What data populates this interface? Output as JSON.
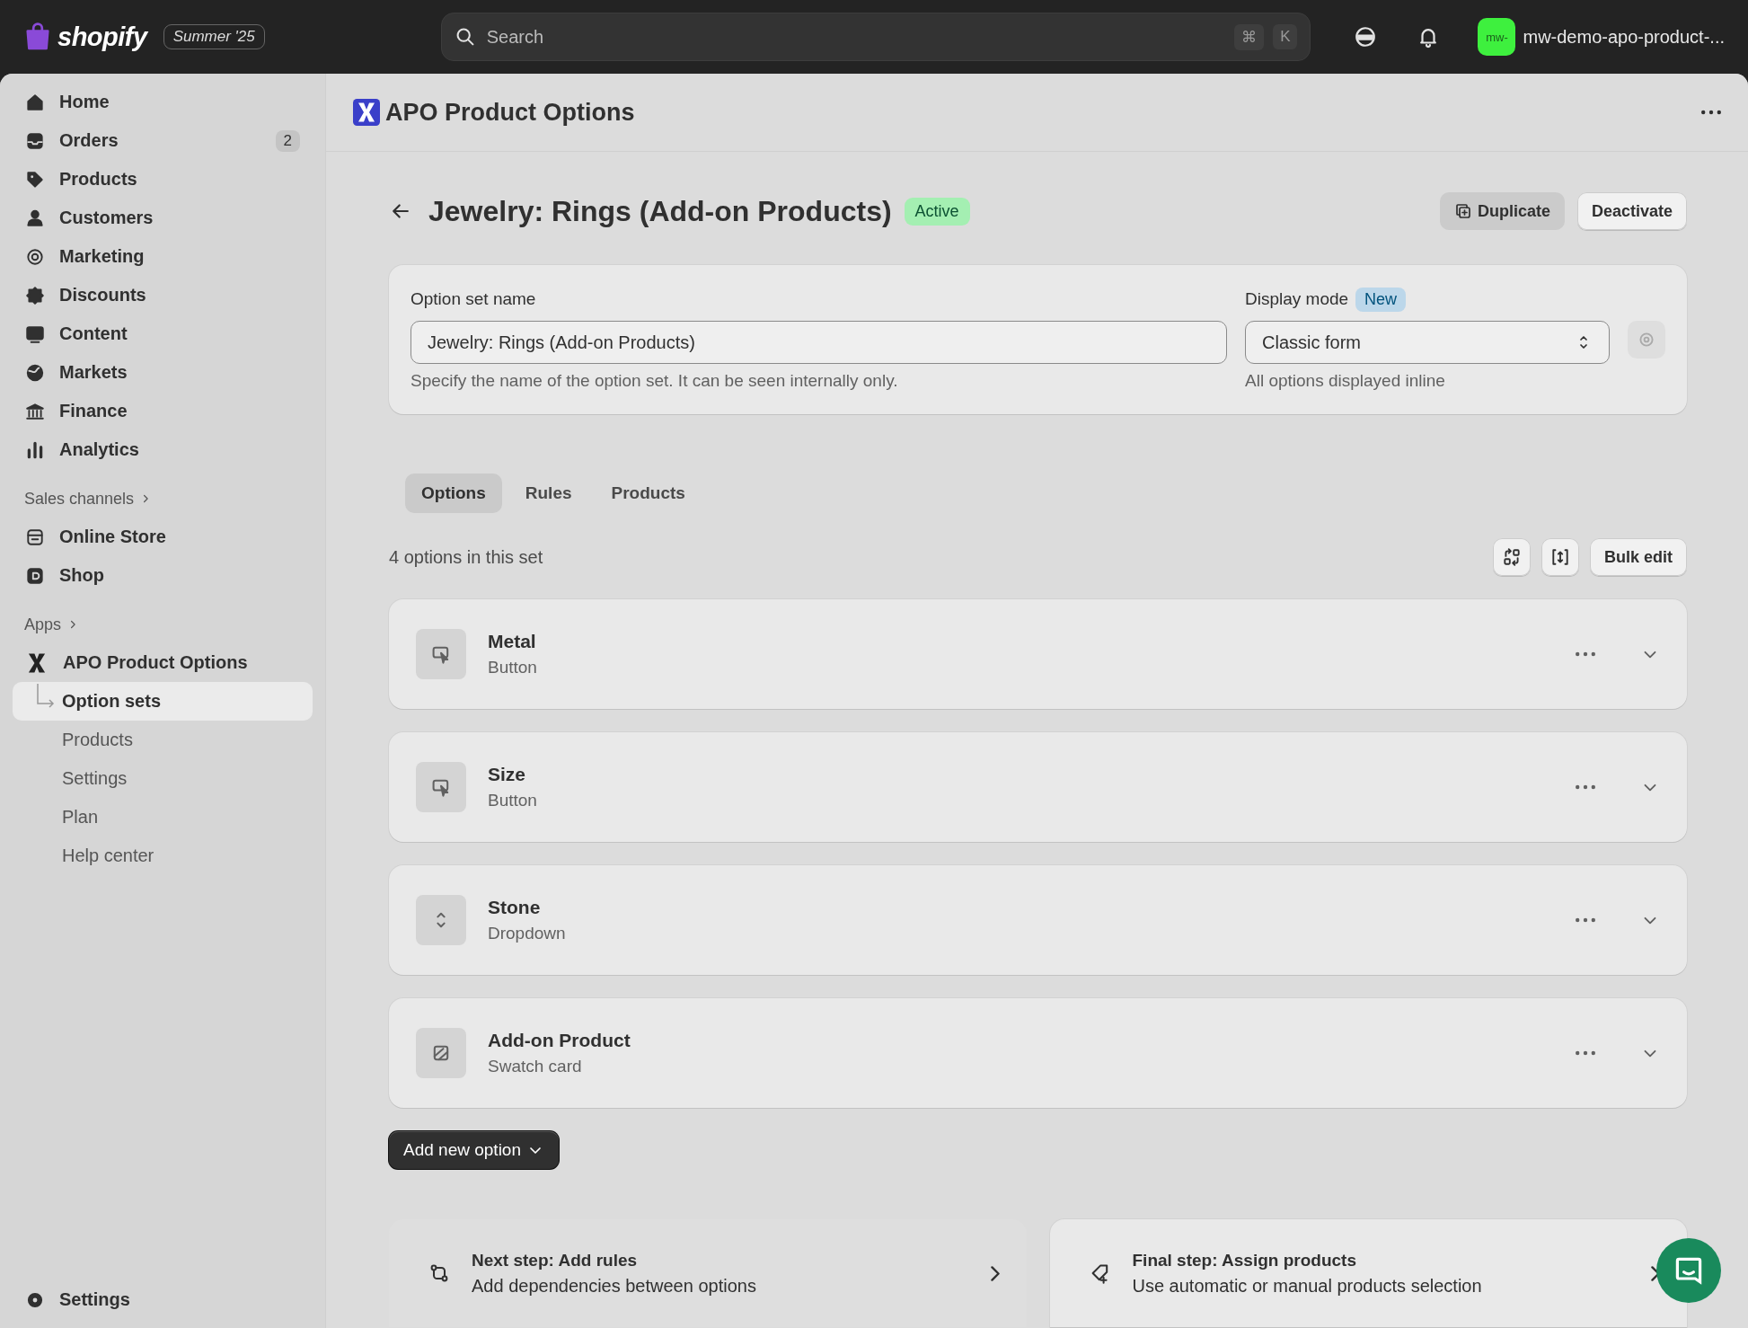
{
  "topbar": {
    "brand": "shopify",
    "edition": "Summer '25",
    "search": {
      "placeholder": "Search"
    },
    "shortcut": [
      "⌘",
      "K"
    ],
    "store": {
      "avatar": "mw-",
      "name": "mw-demo-apo-product-..."
    }
  },
  "sidebar": {
    "items": [
      {
        "label": "Home",
        "selected": false
      },
      {
        "label": "Orders",
        "badge": "2",
        "selected": false
      },
      {
        "label": "Products",
        "selected": false
      },
      {
        "label": "Customers",
        "selected": false
      },
      {
        "label": "Marketing",
        "selected": false
      },
      {
        "label": "Discounts",
        "selected": false
      },
      {
        "label": "Content",
        "selected": false
      },
      {
        "label": "Markets",
        "selected": false
      },
      {
        "label": "Finance",
        "selected": false
      },
      {
        "label": "Analytics",
        "selected": false
      }
    ],
    "sales_channels": {
      "heading": "Sales channels",
      "items": [
        {
          "label": "Online Store",
          "selected": false
        },
        {
          "label": "Shop",
          "selected": false
        }
      ]
    },
    "apps": {
      "heading": "Apps",
      "app": "APO Product Options",
      "children": [
        {
          "label": "Option sets",
          "selected": true
        },
        {
          "label": "Products",
          "selected": false
        },
        {
          "label": "Settings",
          "selected": false
        },
        {
          "label": "Plan",
          "selected": false
        },
        {
          "label": "Help center",
          "selected": false
        }
      ]
    },
    "settings": "Settings"
  },
  "app_header": {
    "title": "APO Product Options"
  },
  "page": {
    "title": "Jewelry: Rings (Add-on Products)",
    "status": "Active",
    "actions": [
      "Duplicate",
      "Deactivate"
    ]
  },
  "form": {
    "name": {
      "label": "Option set name",
      "value": "Jewelry: Rings (Add-on Products)",
      "help": "Specify the name of the option set. It can be seen internally only."
    },
    "display_mode": {
      "label": "Display mode",
      "badge": "New",
      "value": "Classic form",
      "help": "All options displayed inline"
    }
  },
  "tabs": [
    {
      "label": "Options",
      "selected": true
    },
    {
      "label": "Rules",
      "selected": false
    },
    {
      "label": "Products",
      "selected": false
    }
  ],
  "options_count": "4 options in this set",
  "bulk_edit": "Bulk edit",
  "options": [
    {
      "name": "Metal",
      "type": "Button",
      "kind": "button"
    },
    {
      "name": "Size",
      "type": "Button",
      "kind": "button"
    },
    {
      "name": "Stone",
      "type": "Dropdown",
      "kind": "dropdown"
    },
    {
      "name": "Add-on Product",
      "type": "Swatch card",
      "kind": "swatch"
    }
  ],
  "add_option": "Add new option",
  "steps": [
    {
      "title": "Next step: Add rules",
      "text": "Add dependencies between options",
      "kind": "rules"
    },
    {
      "title": "Final step: Assign products",
      "text": "Use automatic or manual products selection",
      "kind": "assign"
    }
  ]
}
